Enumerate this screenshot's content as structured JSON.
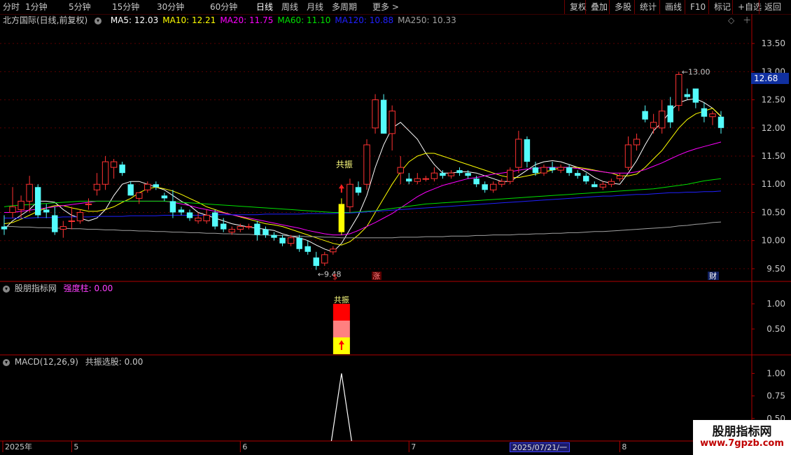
{
  "toolbar": {
    "periods": [
      "分时",
      "1分钟",
      "5分钟",
      "15分钟",
      "30分钟",
      "60分钟",
      "日线",
      "周线",
      "月线",
      "多周期",
      "更多 >"
    ],
    "active": "日线",
    "right_buttons": [
      "复权",
      "叠加",
      "多股",
      "统计",
      "画线",
      "F10",
      "标记",
      "+自选",
      "返回"
    ]
  },
  "main_panel": {
    "title": "北方国际(日线,前复权)",
    "ma": [
      {
        "label": "MA5: 12.03",
        "color": "#ffffff"
      },
      {
        "label": "MA10: 12.21",
        "color": "#ffff00"
      },
      {
        "label": "MA20: 11.75",
        "color": "#ff00ff"
      },
      {
        "label": "MA60: 11.10",
        "color": "#00e000"
      },
      {
        "label": "MA120: 10.88",
        "color": "#2020ff"
      },
      {
        "label": "MA250: 10.33",
        "color": "#a0a0a0"
      }
    ],
    "y_ticks": [
      "13.50",
      "13.00",
      "12.50",
      "12.00",
      "11.50",
      "11.00",
      "10.50",
      "10.00",
      "9.50"
    ],
    "current_price": "12.68",
    "high_label": "13.00",
    "low_label": "9.48",
    "signal_text": "共振",
    "markers": [
      "$",
      "涨",
      "财"
    ]
  },
  "indicator_panel": {
    "title": "股朋指标网",
    "series": "强度柱: 0.00",
    "y_ticks": [
      "1.00",
      "0.50"
    ],
    "top_text": "共振"
  },
  "macd_panel": {
    "title": "MACD(12,26,9)",
    "series": "共振选股: 0.00",
    "y_ticks": [
      "1.00",
      "0.75",
      "0.50"
    ]
  },
  "time_axis": {
    "labels": [
      "2025年",
      "5",
      "6",
      "7",
      "8"
    ],
    "cursor_date": "2025/07/21/一"
  },
  "watermark": {
    "name": "股朋指标网",
    "url": "www.7gpzb.com"
  },
  "colors": {
    "up": "#ff3232",
    "down": "#54fcfc",
    "frame": "#b00000"
  },
  "chart_data": {
    "type": "candlestick",
    "ylim": [
      9.3,
      13.8
    ],
    "candles": [
      {
        "o": 10.25,
        "h": 10.45,
        "l": 10.1,
        "c": 10.2
      },
      {
        "o": 10.5,
        "h": 10.95,
        "l": 10.4,
        "c": 10.6
      },
      {
        "o": 10.55,
        "h": 10.8,
        "l": 10.4,
        "c": 10.7
      },
      {
        "o": 10.7,
        "h": 11.15,
        "l": 10.5,
        "c": 11.0
      },
      {
        "o": 10.95,
        "h": 11.0,
        "l": 10.4,
        "c": 10.45
      },
      {
        "o": 10.55,
        "h": 10.65,
        "l": 10.4,
        "c": 10.5
      },
      {
        "o": 10.45,
        "h": 10.6,
        "l": 10.1,
        "c": 10.15
      },
      {
        "o": 10.2,
        "h": 10.35,
        "l": 10.05,
        "c": 10.25
      },
      {
        "o": 10.35,
        "h": 10.6,
        "l": 10.2,
        "c": 10.35
      },
      {
        "o": 10.35,
        "h": 10.55,
        "l": 10.3,
        "c": 10.5
      },
      {
        "o": 10.65,
        "h": 10.75,
        "l": 10.55,
        "c": 10.65
      },
      {
        "o": 10.9,
        "h": 11.2,
        "l": 10.8,
        "c": 11.0
      },
      {
        "o": 11.0,
        "h": 11.5,
        "l": 10.9,
        "c": 11.4
      },
      {
        "o": 11.3,
        "h": 11.45,
        "l": 11.1,
        "c": 11.4
      },
      {
        "o": 11.35,
        "h": 11.4,
        "l": 11.15,
        "c": 11.2
      },
      {
        "o": 11.0,
        "h": 11.05,
        "l": 10.8,
        "c": 10.8
      },
      {
        "o": 10.75,
        "h": 10.85,
        "l": 10.65,
        "c": 10.85
      },
      {
        "o": 10.9,
        "h": 11.05,
        "l": 10.85,
        "c": 11.0
      },
      {
        "o": 11.0,
        "h": 11.05,
        "l": 10.9,
        "c": 10.95
      },
      {
        "o": 10.8,
        "h": 10.85,
        "l": 10.7,
        "c": 10.75
      },
      {
        "o": 10.7,
        "h": 10.9,
        "l": 10.4,
        "c": 10.5
      },
      {
        "o": 10.55,
        "h": 10.6,
        "l": 10.45,
        "c": 10.5
      },
      {
        "o": 10.5,
        "h": 10.55,
        "l": 10.35,
        "c": 10.4
      },
      {
        "o": 10.35,
        "h": 10.5,
        "l": 10.3,
        "c": 10.4
      },
      {
        "o": 10.35,
        "h": 10.55,
        "l": 10.3,
        "c": 10.45
      },
      {
        "o": 10.5,
        "h": 10.55,
        "l": 10.2,
        "c": 10.25
      },
      {
        "o": 10.3,
        "h": 10.4,
        "l": 10.15,
        "c": 10.2
      },
      {
        "o": 10.15,
        "h": 10.25,
        "l": 10.1,
        "c": 10.2
      },
      {
        "o": 10.2,
        "h": 10.3,
        "l": 10.15,
        "c": 10.25
      },
      {
        "o": 10.25,
        "h": 10.3,
        "l": 10.2,
        "c": 10.25
      },
      {
        "o": 10.3,
        "h": 10.35,
        "l": 10.0,
        "c": 10.1
      },
      {
        "o": 10.2,
        "h": 10.25,
        "l": 10.05,
        "c": 10.1
      },
      {
        "o": 10.1,
        "h": 10.15,
        "l": 10.0,
        "c": 10.05
      },
      {
        "o": 10.05,
        "h": 10.1,
        "l": 9.9,
        "c": 9.95
      },
      {
        "o": 9.95,
        "h": 10.1,
        "l": 9.9,
        "c": 10.05
      },
      {
        "o": 10.05,
        "h": 10.1,
        "l": 9.8,
        "c": 9.85
      },
      {
        "o": 9.9,
        "h": 10.0,
        "l": 9.75,
        "c": 9.8
      },
      {
        "o": 9.7,
        "h": 9.8,
        "l": 9.48,
        "c": 9.55
      },
      {
        "o": 9.6,
        "h": 9.8,
        "l": 9.55,
        "c": 9.75
      },
      {
        "o": 9.8,
        "h": 9.9,
        "l": 9.75,
        "c": 9.85
      },
      {
        "o": 10.15,
        "h": 10.75,
        "l": 10.1,
        "c": 10.65
      },
      {
        "o": 10.6,
        "h": 11.1,
        "l": 10.5,
        "c": 11.0
      },
      {
        "o": 10.95,
        "h": 11.05,
        "l": 10.8,
        "c": 10.85
      },
      {
        "o": 11.0,
        "h": 11.8,
        "l": 10.9,
        "c": 11.7
      },
      {
        "o": 12.0,
        "h": 12.6,
        "l": 11.9,
        "c": 12.5
      },
      {
        "o": 12.5,
        "h": 12.6,
        "l": 11.9,
        "c": 11.9
      },
      {
        "o": 11.9,
        "h": 12.4,
        "l": 11.6,
        "c": 12.3
      },
      {
        "o": 11.2,
        "h": 11.5,
        "l": 11.0,
        "c": 11.3
      },
      {
        "o": 11.1,
        "h": 11.2,
        "l": 11.0,
        "c": 11.05
      },
      {
        "o": 11.05,
        "h": 11.2,
        "l": 11.0,
        "c": 11.1
      },
      {
        "o": 11.1,
        "h": 11.15,
        "l": 11.05,
        "c": 11.1
      },
      {
        "o": 11.1,
        "h": 11.3,
        "l": 11.05,
        "c": 11.2
      },
      {
        "o": 11.2,
        "h": 11.25,
        "l": 11.1,
        "c": 11.15
      },
      {
        "o": 11.15,
        "h": 11.25,
        "l": 11.1,
        "c": 11.2
      },
      {
        "o": 11.25,
        "h": 11.3,
        "l": 11.15,
        "c": 11.2
      },
      {
        "o": 11.2,
        "h": 11.25,
        "l": 11.1,
        "c": 11.15
      },
      {
        "o": 11.1,
        "h": 11.15,
        "l": 10.95,
        "c": 11.0
      },
      {
        "o": 11.0,
        "h": 11.05,
        "l": 10.85,
        "c": 10.9
      },
      {
        "o": 10.9,
        "h": 11.05,
        "l": 10.85,
        "c": 11.0
      },
      {
        "o": 11.0,
        "h": 11.1,
        "l": 10.95,
        "c": 11.05
      },
      {
        "o": 11.05,
        "h": 11.3,
        "l": 11.0,
        "c": 11.25
      },
      {
        "o": 11.3,
        "h": 11.95,
        "l": 11.2,
        "c": 11.8
      },
      {
        "o": 11.8,
        "h": 11.85,
        "l": 11.3,
        "c": 11.4
      },
      {
        "o": 11.3,
        "h": 11.4,
        "l": 11.15,
        "c": 11.2
      },
      {
        "o": 11.2,
        "h": 11.35,
        "l": 11.15,
        "c": 11.3
      },
      {
        "o": 11.3,
        "h": 11.4,
        "l": 11.2,
        "c": 11.25
      },
      {
        "o": 11.25,
        "h": 11.35,
        "l": 11.2,
        "c": 11.3
      },
      {
        "o": 11.3,
        "h": 11.35,
        "l": 11.15,
        "c": 11.2
      },
      {
        "o": 11.2,
        "h": 11.25,
        "l": 11.1,
        "c": 11.15
      },
      {
        "o": 11.15,
        "h": 11.2,
        "l": 11.0,
        "c": 11.05
      },
      {
        "o": 11.0,
        "h": 11.05,
        "l": 10.95,
        "c": 10.95
      },
      {
        "o": 10.95,
        "h": 11.05,
        "l": 10.9,
        "c": 11.0
      },
      {
        "o": 11.0,
        "h": 11.1,
        "l": 10.95,
        "c": 11.05
      },
      {
        "o": 11.1,
        "h": 11.2,
        "l": 11.05,
        "c": 11.15
      },
      {
        "o": 11.3,
        "h": 11.85,
        "l": 11.25,
        "c": 11.7
      },
      {
        "o": 11.7,
        "h": 11.9,
        "l": 11.6,
        "c": 11.8
      },
      {
        "o": 12.3,
        "h": 12.4,
        "l": 12.1,
        "c": 12.15
      },
      {
        "o": 12.0,
        "h": 12.25,
        "l": 11.9,
        "c": 12.1
      },
      {
        "o": 12.0,
        "h": 12.5,
        "l": 11.9,
        "c": 12.3
      },
      {
        "o": 12.4,
        "h": 12.55,
        "l": 12.0,
        "c": 12.1
      },
      {
        "o": 12.4,
        "h": 13.0,
        "l": 12.3,
        "c": 12.95
      },
      {
        "o": 12.6,
        "h": 12.7,
        "l": 12.5,
        "c": 12.55
      },
      {
        "o": 12.7,
        "h": 12.7,
        "l": 12.35,
        "c": 12.45
      },
      {
        "o": 12.35,
        "h": 12.45,
        "l": 12.1,
        "c": 12.2
      },
      {
        "o": 12.2,
        "h": 12.3,
        "l": 12.05,
        "c": 12.25
      },
      {
        "o": 12.2,
        "h": 12.3,
        "l": 11.9,
        "c": 12.0
      }
    ],
    "ma_lines": {
      "MA5": [
        10.2,
        10.35,
        10.45,
        10.55,
        10.7,
        10.7,
        10.68,
        10.55,
        10.45,
        10.4,
        10.35,
        10.4,
        10.55,
        10.8,
        11.0,
        11.05,
        11.05,
        11.0,
        10.95,
        10.9,
        10.8,
        10.7,
        10.62,
        10.5,
        10.45,
        10.4,
        10.35,
        10.3,
        10.27,
        10.24,
        10.22,
        10.2,
        10.18,
        10.12,
        10.08,
        10.05,
        10.0,
        9.92,
        9.85,
        9.8,
        9.95,
        10.2,
        10.45,
        10.8,
        11.3,
        11.7,
        12.0,
        12.1,
        11.95,
        11.8,
        11.55,
        11.35,
        11.2,
        11.2,
        11.22,
        11.22,
        11.2,
        11.15,
        11.1,
        11.05,
        11.05,
        11.15,
        11.25,
        11.35,
        11.4,
        11.42,
        11.4,
        11.35,
        11.3,
        11.22,
        11.12,
        11.05,
        11.02,
        11.0,
        11.2,
        11.42,
        11.7,
        11.95,
        12.1,
        12.3,
        12.45,
        12.5,
        12.52,
        12.45,
        12.35,
        12.2
      ],
      "MA10": [
        10.3,
        10.32,
        10.38,
        10.45,
        10.52,
        10.58,
        10.62,
        10.62,
        10.58,
        10.55,
        10.52,
        10.52,
        10.55,
        10.6,
        10.68,
        10.75,
        10.85,
        10.92,
        10.95,
        10.92,
        10.88,
        10.82,
        10.75,
        10.68,
        10.6,
        10.55,
        10.5,
        10.46,
        10.42,
        10.38,
        10.34,
        10.3,
        10.28,
        10.25,
        10.2,
        10.15,
        10.1,
        10.05,
        10.0,
        9.95,
        9.92,
        9.98,
        10.1,
        10.25,
        10.5,
        10.75,
        11.0,
        11.22,
        11.4,
        11.5,
        11.55,
        11.55,
        11.5,
        11.45,
        11.4,
        11.35,
        11.3,
        11.25,
        11.2,
        11.15,
        11.12,
        11.12,
        11.15,
        11.18,
        11.22,
        11.25,
        11.3,
        11.3,
        11.3,
        11.28,
        11.25,
        11.22,
        11.2,
        11.15,
        11.15,
        11.18,
        11.3,
        11.45,
        11.6,
        11.8,
        12.0,
        12.15,
        12.25,
        12.3,
        12.35,
        12.21
      ],
      "MA20": [
        10.5,
        10.5,
        10.52,
        10.54,
        10.56,
        10.58,
        10.6,
        10.62,
        10.64,
        10.66,
        10.68,
        10.7,
        10.7,
        10.7,
        10.7,
        10.7,
        10.7,
        10.7,
        10.7,
        10.7,
        10.68,
        10.65,
        10.62,
        10.58,
        10.55,
        10.52,
        10.49,
        10.46,
        10.43,
        10.4,
        10.37,
        10.34,
        10.31,
        10.28,
        10.25,
        10.22,
        10.18,
        10.15,
        10.12,
        10.1,
        10.1,
        10.12,
        10.18,
        10.25,
        10.32,
        10.4,
        10.48,
        10.58,
        10.68,
        10.78,
        10.86,
        10.92,
        10.98,
        11.02,
        11.06,
        11.1,
        11.12,
        11.15,
        11.18,
        11.2,
        11.22,
        11.25,
        11.27,
        11.28,
        11.3,
        11.3,
        11.3,
        11.3,
        11.28,
        11.26,
        11.24,
        11.22,
        11.2,
        11.2,
        11.2,
        11.22,
        11.26,
        11.32,
        11.38,
        11.45,
        11.52,
        11.58,
        11.63,
        11.67,
        11.71,
        11.75
      ],
      "MA60": [
        10.6,
        10.62,
        10.63,
        10.64,
        10.65,
        10.66,
        10.67,
        10.68,
        10.69,
        10.7,
        10.7,
        10.7,
        10.7,
        10.7,
        10.7,
        10.7,
        10.7,
        10.7,
        10.7,
        10.7,
        10.69,
        10.68,
        10.67,
        10.66,
        10.65,
        10.64,
        10.63,
        10.62,
        10.61,
        10.6,
        10.59,
        10.58,
        10.57,
        10.56,
        10.55,
        10.54,
        10.53,
        10.52,
        10.51,
        10.5,
        10.5,
        10.5,
        10.51,
        10.52,
        10.53,
        10.55,
        10.57,
        10.59,
        10.61,
        10.63,
        10.65,
        10.66,
        10.67,
        10.68,
        10.69,
        10.7,
        10.71,
        10.72,
        10.73,
        10.74,
        10.75,
        10.76,
        10.77,
        10.78,
        10.79,
        10.8,
        10.81,
        10.82,
        10.83,
        10.84,
        10.85,
        10.86,
        10.87,
        10.88,
        10.89,
        10.9,
        10.91,
        10.92,
        10.94,
        10.96,
        10.98,
        11.0,
        11.03,
        11.06,
        11.08,
        11.1
      ],
      "MA120": [
        10.4,
        10.4,
        10.4,
        10.4,
        10.41,
        10.41,
        10.41,
        10.42,
        10.42,
        10.42,
        10.42,
        10.43,
        10.43,
        10.43,
        10.43,
        10.44,
        10.44,
        10.44,
        10.44,
        10.45,
        10.45,
        10.45,
        10.45,
        10.45,
        10.45,
        10.46,
        10.46,
        10.46,
        10.46,
        10.46,
        10.46,
        10.47,
        10.47,
        10.47,
        10.47,
        10.47,
        10.48,
        10.48,
        10.48,
        10.48,
        10.49,
        10.49,
        10.5,
        10.51,
        10.52,
        10.53,
        10.54,
        10.55,
        10.56,
        10.57,
        10.58,
        10.59,
        10.6,
        10.61,
        10.62,
        10.63,
        10.64,
        10.65,
        10.66,
        10.67,
        10.68,
        10.69,
        10.7,
        10.71,
        10.72,
        10.73,
        10.74,
        10.75,
        10.76,
        10.77,
        10.78,
        10.79,
        10.79,
        10.8,
        10.81,
        10.82,
        10.82,
        10.83,
        10.84,
        10.85,
        10.85,
        10.86,
        10.86,
        10.87,
        10.87,
        10.88
      ],
      "MA250": [
        10.25,
        10.25,
        10.24,
        10.24,
        10.23,
        10.23,
        10.22,
        10.22,
        10.21,
        10.21,
        10.2,
        10.2,
        10.19,
        10.19,
        10.18,
        10.18,
        10.17,
        10.17,
        10.16,
        10.16,
        10.15,
        10.15,
        10.14,
        10.14,
        10.13,
        10.13,
        10.12,
        10.12,
        10.11,
        10.11,
        10.1,
        10.1,
        10.09,
        10.09,
        10.08,
        10.08,
        10.07,
        10.07,
        10.06,
        10.06,
        10.05,
        10.05,
        10.05,
        10.05,
        10.05,
        10.05,
        10.05,
        10.06,
        10.06,
        10.06,
        10.07,
        10.07,
        10.07,
        10.08,
        10.08,
        10.08,
        10.09,
        10.09,
        10.1,
        10.1,
        10.1,
        10.11,
        10.11,
        10.12,
        10.12,
        10.13,
        10.13,
        10.14,
        10.14,
        10.15,
        10.16,
        10.16,
        10.17,
        10.18,
        10.19,
        10.2,
        10.21,
        10.22,
        10.23,
        10.24,
        10.26,
        10.27,
        10.29,
        10.3,
        10.32,
        10.33
      ]
    },
    "signal_candle_index": 40,
    "indicator_bar": {
      "index": 40,
      "value": 1.0,
      "segments": [
        "#ff0000",
        "#ff8080",
        "#ffff00"
      ]
    },
    "macd_spike": {
      "index": 40,
      "value": 1.0
    }
  }
}
